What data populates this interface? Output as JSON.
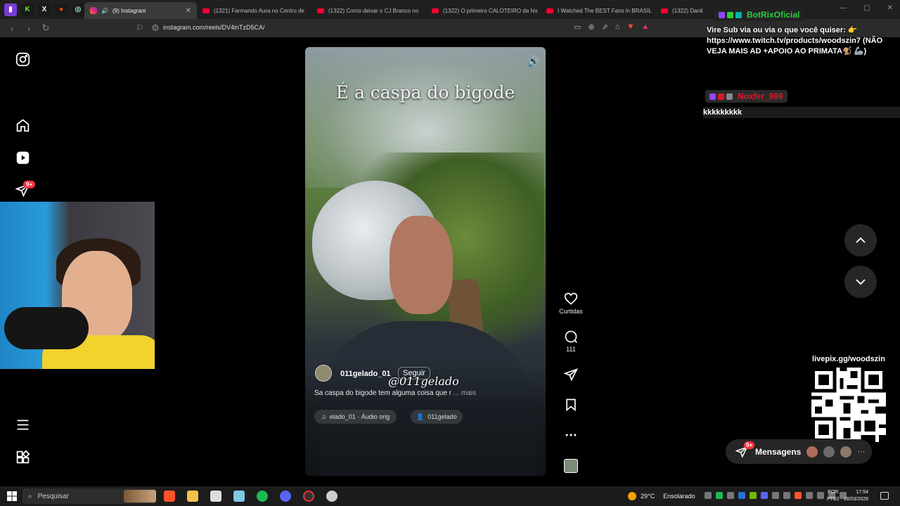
{
  "browser": {
    "tabs": [
      {
        "label": "(9) Instagram",
        "active": true
      },
      {
        "label": "(1321) Farmando Aura no Centro de"
      },
      {
        "label": "(1322) Como deixar o CJ Branco no"
      },
      {
        "label": "(1322) O primeiro CALOTEIRO da his"
      },
      {
        "label": "I Watched The BEST Fans in BRASIL"
      },
      {
        "label": "(1322) Danil"
      }
    ],
    "url": "instagram.com/reels/DV4inTzD5CA/"
  },
  "instagram": {
    "notification_badge": "9+",
    "reel": {
      "overlay_text": "É a caspa do bigode",
      "watermark": "@011gelado",
      "username": "011gelado_01",
      "follow_label": "Seguir",
      "description": "Sa caspa do bigode tem alguma coisa que r",
      "more_label": "... mais",
      "audio_label": "elado_01 · Áudio orig",
      "tagged_user": "011gelado"
    },
    "actions": {
      "like_label": "Curtidas",
      "comments_count": "111"
    },
    "messages": {
      "label": "Mensagens",
      "badge": "9+"
    }
  },
  "chat": {
    "user1": "BotRixOficial",
    "message1": "Vire Sub via  ou via o que você quiser: 👉 https://www.twitch.tv/products/woodszin7 (NÃO VEJA MAIS AD +APOIO AO PRIMATA🐒 🦾)",
    "user2": "Noxfer_999",
    "message2": "kkkkkkkkk"
  },
  "livepix": {
    "label": "livepix.gg/woodszin"
  },
  "taskbar": {
    "search_placeholder": "Pesquisar",
    "temperature": "29°C",
    "weather_text": "Ensolarado",
    "lang_line1": "POR",
    "lang_line2": "PTB2",
    "time": "17:54",
    "date": "28/03/2026"
  }
}
